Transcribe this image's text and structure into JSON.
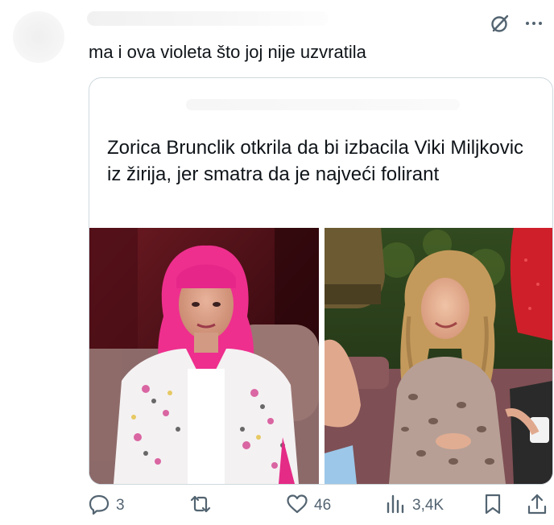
{
  "tweet": {
    "text": "ma i ova violeta što joj nije uzvratila"
  },
  "card": {
    "title": "Zorica Brunclik otkrila da bi izbacila Viki Miljkovic iz žirija, jer smatra da je najveći folirant"
  },
  "actions": {
    "replies": "3",
    "retweets": "",
    "likes": "46",
    "views": "3,4K"
  },
  "icons": {
    "grok": "grok-icon",
    "more": "more-icon",
    "reply": "reply-icon",
    "retweet": "retweet-icon",
    "like": "heart-icon",
    "views": "views-icon",
    "bookmark": "bookmark-icon",
    "share": "share-icon"
  },
  "colors": {
    "text": "#0f1419",
    "secondary": "#536471",
    "border": "#cfd9de"
  }
}
